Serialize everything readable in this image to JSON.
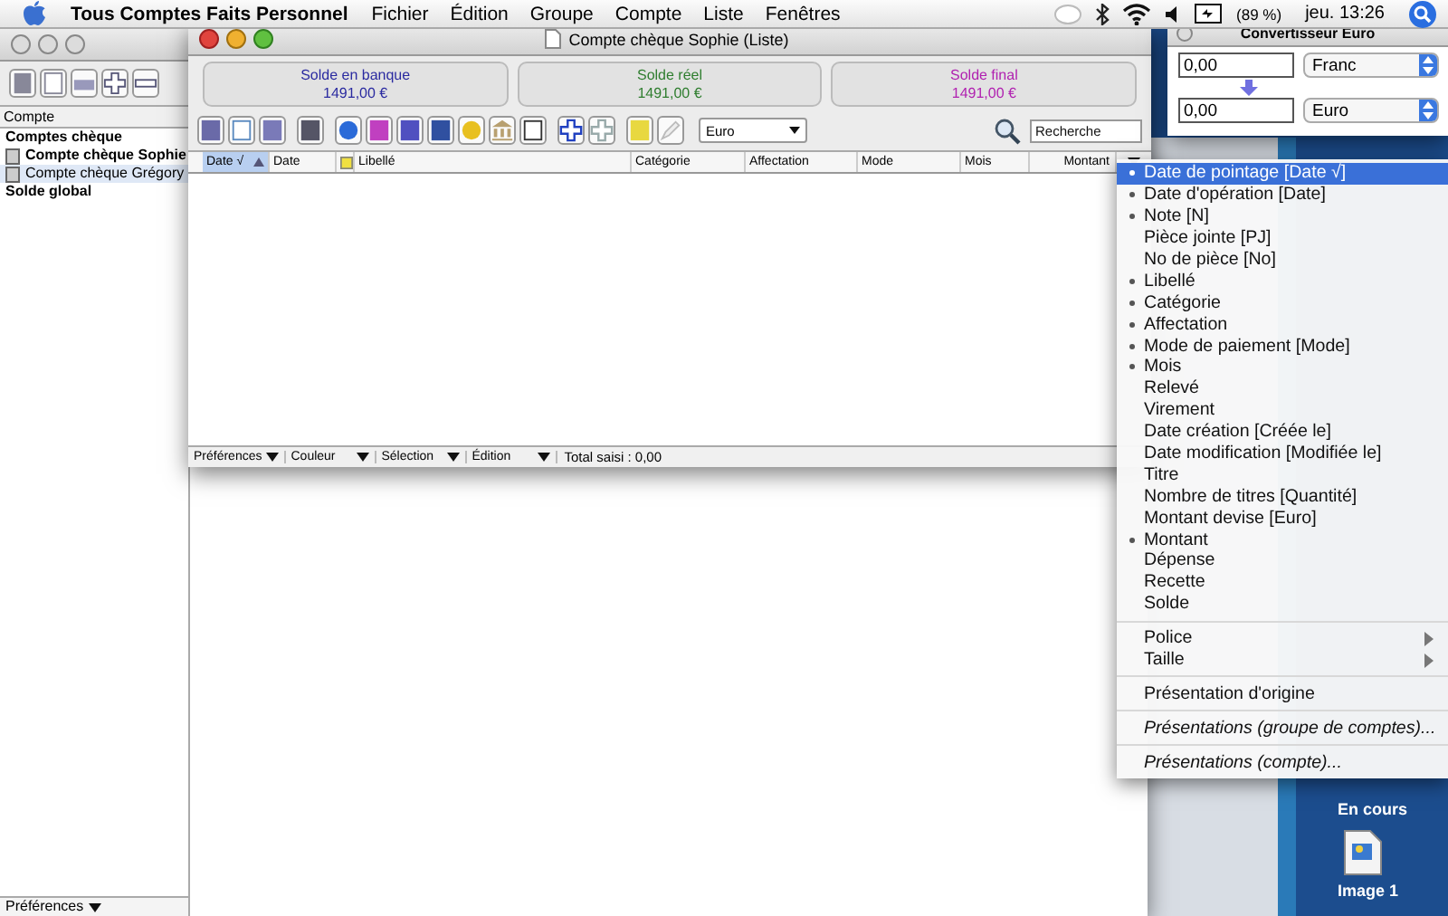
{
  "menu_bar": {
    "app_name": "Tous Comptes Faits Personnel",
    "menus": [
      "Fichier",
      "Édition",
      "Groupe",
      "Compte",
      "Liste",
      "Fenêtres"
    ],
    "battery": "(89 %)",
    "clock": "jeu. 13:26"
  },
  "accounts_window": {
    "column_header": "Compte",
    "items": [
      {
        "label": "Comptes chèque",
        "kind": "group",
        "selected": false
      },
      {
        "label": "Compte chèque Sophie",
        "kind": "account",
        "open": true,
        "selected": false
      },
      {
        "label": "Compte chèque Grégory",
        "kind": "account",
        "open": false,
        "selected": true
      },
      {
        "label": "Solde global",
        "kind": "total",
        "selected": false
      }
    ],
    "footer_menu": "Préférences"
  },
  "list_window": {
    "title": "Compte chèque Sophie (Liste)",
    "balances": [
      {
        "label": "Solde en banque",
        "value": "1491,00 €",
        "color": "#2a2aa0"
      },
      {
        "label": "Solde réel",
        "value": "1491,00 €",
        "color": "#2e7d2e"
      },
      {
        "label": "Solde final",
        "value": "1491,00 €",
        "color": "#b020b0"
      }
    ],
    "currency": "Euro",
    "search": {
      "placeholder": "Recherche"
    },
    "columns": [
      {
        "label": "Date √",
        "kind": "text",
        "selected": true
      },
      {
        "label": "Date",
        "kind": "text",
        "selected": false
      },
      {
        "kind": "note",
        "selected": false
      },
      {
        "label": "Libellé",
        "kind": "text",
        "selected": false
      },
      {
        "label": "Catégorie",
        "kind": "text",
        "selected": false
      },
      {
        "label": "Affectation",
        "kind": "text",
        "selected": false
      },
      {
        "label": "Mode",
        "kind": "text",
        "selected": false
      },
      {
        "label": "Mois",
        "kind": "text",
        "selected": false
      },
      {
        "label": "Montant",
        "kind": "number",
        "selected": false
      }
    ],
    "footer_menus": [
      "Préférences",
      "Couleur",
      "Sélection",
      "Édition"
    ],
    "total": "Total saisi : 0,00"
  },
  "converter": {
    "title": "Convertisseur Euro",
    "rows": [
      {
        "value": "0,00",
        "currency": "Franc"
      },
      {
        "value": "0,00",
        "currency": "Euro"
      }
    ]
  },
  "context_menu": {
    "groups": [
      [
        {
          "label": "Date de pointage [Date √]",
          "kind": "plain",
          "checked": true,
          "selected": true
        },
        {
          "label": "Date d'opération [Date]",
          "kind": "plain",
          "checked": true,
          "selected": false
        },
        {
          "label": "Note [N]",
          "kind": "plain",
          "checked": true,
          "selected": false
        },
        {
          "label": "Pièce jointe [PJ]",
          "kind": "plain",
          "checked": false,
          "selected": false
        },
        {
          "label": "No de pièce [No]",
          "kind": "plain",
          "checked": false,
          "selected": false
        },
        {
          "label": "Libellé",
          "kind": "plain",
          "checked": true,
          "selected": false
        },
        {
          "label": "Catégorie",
          "kind": "plain",
          "checked": true,
          "selected": false
        },
        {
          "label": "Affectation",
          "kind": "plain",
          "checked": true,
          "selected": false
        },
        {
          "label": "Mode de paiement [Mode]",
          "kind": "plain",
          "checked": true,
          "selected": false
        },
        {
          "label": "Mois",
          "kind": "plain",
          "checked": true,
          "selected": false
        },
        {
          "label": "Relevé",
          "kind": "plain",
          "checked": false,
          "selected": false
        },
        {
          "label": "Virement",
          "kind": "plain",
          "checked": false,
          "selected": false
        },
        {
          "label": "Date création [Créée le]",
          "kind": "plain",
          "checked": false,
          "selected": false
        },
        {
          "label": "Date modification [Modifiée le]",
          "kind": "plain",
          "checked": false,
          "selected": false
        },
        {
          "label": "Titre",
          "kind": "plain",
          "checked": false,
          "selected": false
        },
        {
          "label": "Nombre de titres [Quantité]",
          "kind": "plain",
          "checked": false,
          "selected": false
        },
        {
          "label": "Montant devise [Euro]",
          "kind": "plain",
          "checked": false,
          "selected": false
        },
        {
          "label": "Montant",
          "kind": "plain",
          "checked": true,
          "selected": false
        },
        {
          "label": "Dépense",
          "kind": "plain",
          "checked": false,
          "selected": false
        },
        {
          "label": "Recette",
          "kind": "plain",
          "checked": false,
          "selected": false
        },
        {
          "label": "Solde",
          "kind": "plain",
          "checked": false,
          "selected": false
        }
      ],
      [
        {
          "label": "Police",
          "kind": "submenu",
          "checked": false,
          "selected": false
        },
        {
          "label": "Taille",
          "kind": "submenu",
          "checked": false,
          "selected": false
        }
      ],
      [
        {
          "label": "Présentation d'origine",
          "kind": "plain",
          "checked": false,
          "selected": false
        }
      ],
      [
        {
          "label": "Présentations (groupe de comptes)...",
          "kind": "italic",
          "checked": false,
          "selected": false
        }
      ],
      [
        {
          "label": "Présentations (compte)...",
          "kind": "italic",
          "checked": false,
          "selected": false
        }
      ]
    ]
  },
  "desktop": {
    "folder_label": "En cours",
    "file_label": "Image 1"
  }
}
